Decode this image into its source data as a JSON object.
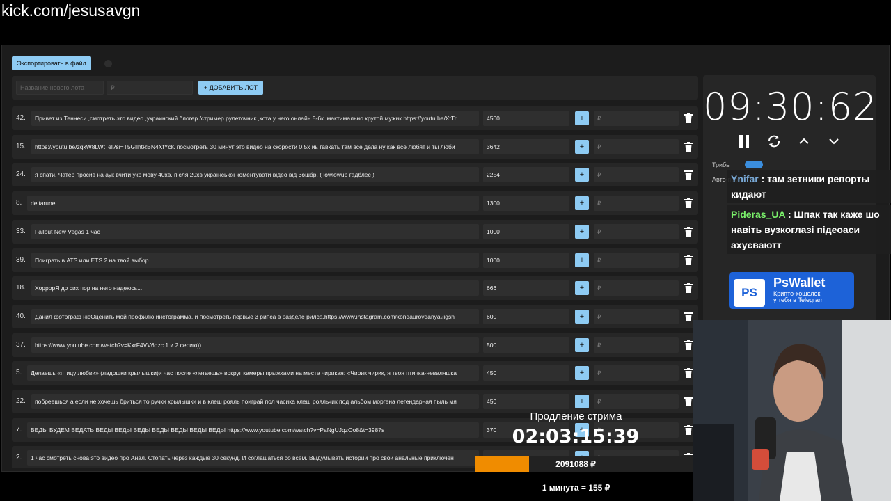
{
  "url": "kick.com/jesusavgn",
  "toolbar": {
    "export_label": "Экспортировать в файл"
  },
  "add_lot": {
    "name_placeholder": "Название нового лота",
    "amount_placeholder": "₽",
    "add_label": "+ ДОБАВИТЬ ЛОТ"
  },
  "lots": [
    {
      "num": "42.",
      "title": "Привет из Теннеси ,смотреть это видео ,украинский блогер /стример рулеточник ,кста у него онлайн 5-6к ,мактимально крутой мужик https://youtu.be/XtTr",
      "amount": "4500",
      "plus": "+",
      "rub": "₽"
    },
    {
      "num": "15.",
      "title": "https://youtu.be/zqxW8LWtTel?si=T5GllhtRBN4XtYcK посмотреть 30 минут это видео на скорости 0.5x иь гавкать там все дела ну как все любят и ты люби",
      "amount": "3642",
      "plus": "+",
      "rub": "₽"
    },
    {
      "num": "24.",
      "title": "я спати. Чатер просив на аук вчити укр мову 40хв. після 20хв української коментувати відео від 3ошбр. ( lowlowup гадблес )",
      "amount": "2254",
      "plus": "+",
      "rub": "₽"
    },
    {
      "num": "8.",
      "title": "deltarune",
      "amount": "1300",
      "plus": "+",
      "rub": "₽"
    },
    {
      "num": "33.",
      "title": "Fallout New Vegas 1 час",
      "amount": "1000",
      "plus": "+",
      "rub": "₽"
    },
    {
      "num": "39.",
      "title": "Поиграть в ATS или ETS 2 на твой выбор",
      "amount": "1000",
      "plus": "+",
      "rub": "₽"
    },
    {
      "num": "18.",
      "title": "ХоррорЯ до сих пор на него надеюсь...",
      "amount": "666",
      "plus": "+",
      "rub": "₽"
    },
    {
      "num": "40.",
      "title": "Данил фотограф нюОценить мой профилю инстограмма, и посмотреть первые 3 рипса в разделе рилса.https://www.instagram.com/kondaurovdanya?igsh",
      "amount": "600",
      "plus": "+",
      "rub": "₽"
    },
    {
      "num": "37.",
      "title": "https://www.youtube.com/watch?v=KxrF4VV6qzc 1 и 2 серию))",
      "amount": "500",
      "plus": "+",
      "rub": "₽"
    },
    {
      "num": "5.",
      "title": "Делаешь «птицу любви» (ладошки крылышки)и час после «летаешь» вокруг камеры прыжками на месте чирикая: «Чирик чирик, я твоя птичка-неваляшка",
      "amount": "450",
      "plus": "+",
      "rub": "₽"
    },
    {
      "num": "22.",
      "title": "побреешься а если не хочешь бриться то ручки крылышки и в клеш рояль поиграй пол часика клеш рояльчик под альбом моргена легендарная пыль мя",
      "amount": "450",
      "plus": "+",
      "rub": "₽"
    },
    {
      "num": "7.",
      "title": "ВЕДЫ БУДЕМ ВЕДАТЬ ВЕДЫ ВЕДЫ ВЕДЫ ВЕДЫ ВЕДЫ ВЕДЫ ВЕДЫ https://www.youtube.com/watch?v=PaNgUJqzOo8&t=3987s",
      "amount": "370",
      "plus": "+",
      "rub": "₽"
    },
    {
      "num": "2.",
      "title": "1 час смотреть снова это видео про Анал. Стопать через каждые 30 секунд. И соглашаться со всем. Выдумывать истории про свои анальные приключен",
      "amount": "333",
      "plus": "+",
      "rub": "₽"
    }
  ],
  "timer": {
    "display": "09:30:62"
  },
  "side": {
    "label1": "Трибы",
    "label2": "Авто-про"
  },
  "chat": [
    {
      "user": "Ynifar",
      "sep": " : ",
      "text": "там зетники репорты кидают"
    },
    {
      "user": "Pideras_UA",
      "sep": " : ",
      "text": "Шпак так каже шо навіть вузкоглазі підеоаси ахуєваютт"
    }
  ],
  "pswallet": {
    "logo": "PS",
    "name": "PsWallet",
    "sub1": "Крипто-кошелек",
    "sub2": "у тебя в Telegram"
  },
  "extension": {
    "title": "Продление стрима",
    "timer": "02:03:15:39",
    "total": "2091088 ₽",
    "progress_fraction": 0.25,
    "rate": "1 минута = 155 ₽"
  },
  "colors": {
    "accent": "#8ecbf3",
    "progress": "#f08c00",
    "chat_user": "#7bf26b",
    "wallet": "#1d62d8"
  }
}
